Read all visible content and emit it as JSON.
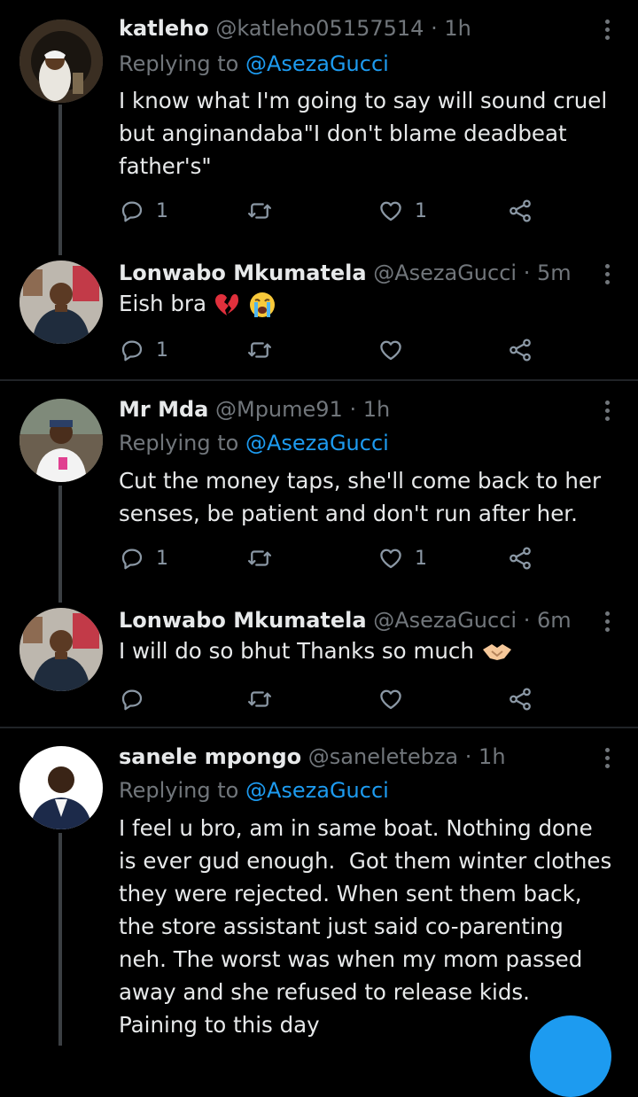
{
  "colors": {
    "background": "#000000",
    "text": "#e7e9ea",
    "muted": "#71767b",
    "accent": "#1d9bf0",
    "thread": "#3b3f43"
  },
  "tweets": [
    {
      "name": "katleho",
      "handle": "@katleho05157514",
      "dot": "·",
      "time": "1h",
      "replying_prefix": "Replying to",
      "replying_to": "@AsezaGucci",
      "lines": [
        "I know what I'm going to say will sound cruel",
        "but anginandaba\"I don't blame deadbeat",
        "father's\""
      ],
      "reply_count": "1",
      "like_count": "1"
    },
    {
      "name": "Lonwabo Mkumatela",
      "handle": "@AsezaGucci",
      "dot": "·",
      "time": "5m",
      "lines": [
        "Eish bra"
      ],
      "emoji": [
        "broken-heart-emoji",
        "loudly-crying-face-emoji"
      ],
      "reply_count": "1",
      "like_count": ""
    },
    {
      "name": "Mr Mda",
      "handle": "@Mpume91",
      "dot": "·",
      "time": "1h",
      "replying_prefix": "Replying to",
      "replying_to": "@AsezaGucci",
      "lines": [
        "Cut the money taps, she'll come back to her",
        "senses, be patient and don't run after her."
      ],
      "reply_count": "1",
      "like_count": "1"
    },
    {
      "name": "Lonwabo Mkumatela",
      "handle": "@AsezaGucci",
      "dot": "·",
      "time": "6m",
      "lines": [
        "I will do so bhut Thanks so much"
      ],
      "emoji": [
        "handshake-emoji"
      ],
      "reply_count": "",
      "like_count": ""
    },
    {
      "name": "sanele mpongo",
      "handle": "@saneletebza",
      "dot": "·",
      "time": "1h",
      "replying_prefix": "Replying to",
      "replying_to": "@AsezaGucci",
      "lines": [
        "I feel u bro, am in same boat. Nothing done",
        "is ever gud enough.  Got them winter clothes",
        "they were rejected. When sent them back,",
        "the store assistant just said co-parenting",
        "neh. The worst was when my mom passed",
        "away and she refused to release kids.",
        "Paining to this day"
      ]
    }
  ],
  "icons": [
    "reply-icon",
    "retweet-icon",
    "like-icon",
    "share-icon",
    "more-options-icon",
    "compose-fab"
  ]
}
